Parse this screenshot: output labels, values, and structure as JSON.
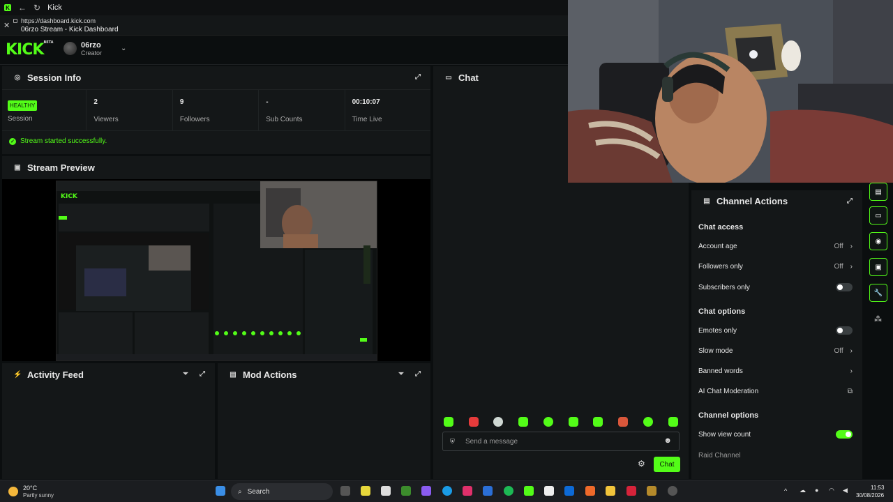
{
  "browser": {
    "tab_title": "Kick",
    "url": "https://dashboard.kick.com",
    "page_title": "06rzo Stream - Kick Dashboard"
  },
  "header": {
    "logo": "KICK",
    "logo_tag": "BETA",
    "username": "06rzo",
    "role": "Creator"
  },
  "session": {
    "title": "Session Info",
    "status_badge": "HEALTHY",
    "status_label": "Session",
    "viewers_value": "2",
    "viewers_label": "Viewers",
    "followers_value": "9",
    "followers_label": "Followers",
    "subs_value": "-",
    "subs_label": "Sub Counts",
    "time_value": "00:10:07",
    "time_label": "Time Live",
    "message": "Stream started successfully."
  },
  "preview": {
    "title": "Stream Preview"
  },
  "activity": {
    "title": "Activity Feed"
  },
  "mod": {
    "title": "Mod Actions"
  },
  "chat": {
    "title": "Chat",
    "placeholder": "Send a message",
    "send_label": "Chat"
  },
  "channel_actions": {
    "title": "Channel Actions",
    "chat_access": "Chat access",
    "account_age": "Account age",
    "account_age_val": "Off",
    "followers_only": "Followers only",
    "followers_only_val": "Off",
    "subscribers_only": "Subscribers only",
    "chat_options": "Chat options",
    "emotes_only": "Emotes only",
    "slow_mode": "Slow mode",
    "slow_mode_val": "Off",
    "banned_words": "Banned words",
    "ai_moderation": "AI Chat Moderation",
    "channel_options": "Channel options",
    "show_view_count": "Show view count",
    "raid_channel": "Raid Channel"
  },
  "taskbar": {
    "temp": "20°C",
    "weather": "Partly sunny",
    "search": "Search",
    "time": "11:53",
    "date": "30/08/2026"
  },
  "colors": {
    "accent": "#53fc18",
    "panel": "#141718",
    "bg": "#0b0e0f"
  }
}
